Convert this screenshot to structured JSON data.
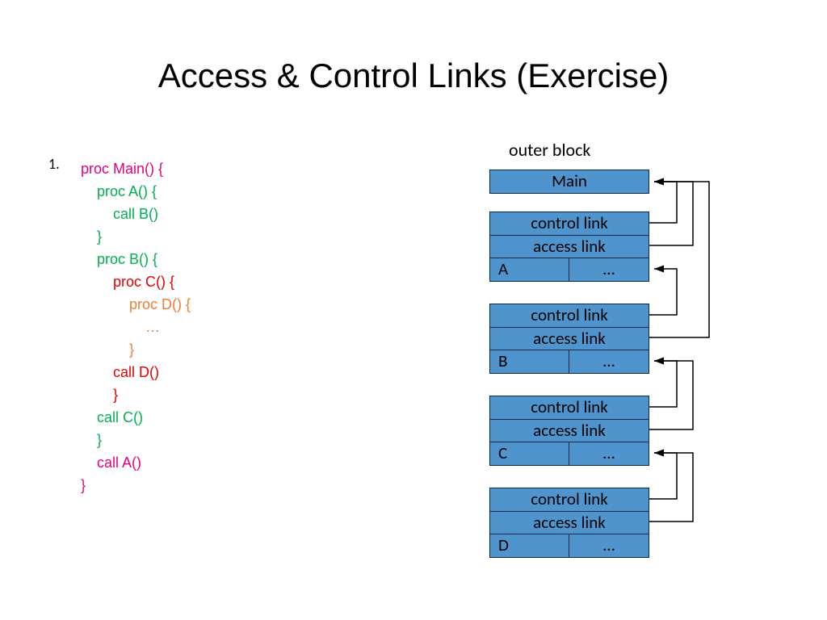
{
  "title": "Access & Control Links (Exercise)",
  "list_number": "1.",
  "code": {
    "l1": "proc Main() {",
    "l2": "proc A() {",
    "l3": "call B()",
    "l4": "}",
    "l5": "proc B() {",
    "l6": "proc C() {",
    "l7": "proc D() {",
    "l8": "…",
    "l9": "}",
    "l10": "call D()",
    "l11": "}",
    "l12": "call C()",
    "l13": "}",
    "l14": "call A()",
    "l15": "}"
  },
  "diagram": {
    "outer_label": "outer block",
    "main": "Main",
    "control": "control link",
    "access": "access link",
    "ellipsis": "…",
    "frames": {
      "A": "A",
      "B": "B",
      "C": "C",
      "D": "D"
    }
  }
}
